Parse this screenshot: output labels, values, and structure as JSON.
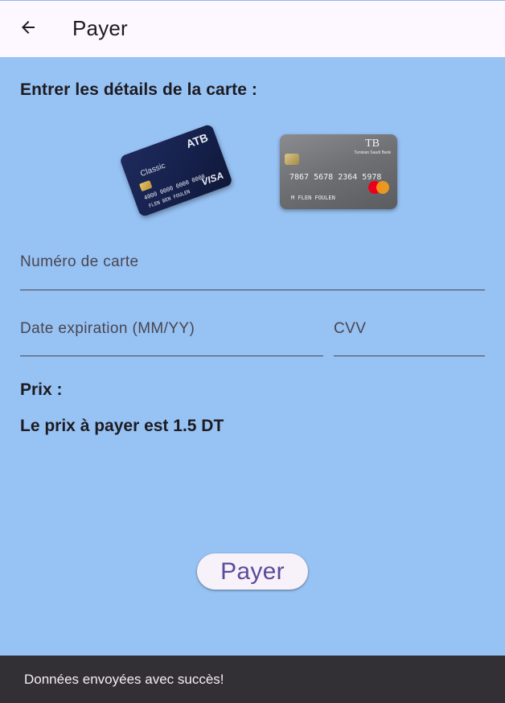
{
  "appbar": {
    "title": "Payer",
    "back_icon": "arrow-left-icon"
  },
  "card_section": {
    "title": "Entrer les détails de la carte :",
    "cards": [
      {
        "name": "ATB Classic Visa",
        "brand": "ATB",
        "tier": "Classic",
        "network": "VISA",
        "number": "4000 0000 0000 0000",
        "holder": "FLEN BEN FOULEN",
        "color": "#1e2a5c"
      },
      {
        "name": "Tunisian Saudi Bank Mastercard",
        "brand": "TB",
        "bank_name": "Tunisian Saudi Bank",
        "number": "7867 5678 2364 5978",
        "holder": "M FLEN FOULEN",
        "network": "mastercard",
        "color": "#6f7174"
      }
    ]
  },
  "form": {
    "card_number": {
      "label": "Numéro de carte",
      "value": ""
    },
    "expiration": {
      "label": "Date expiration (MM/YY)",
      "value": ""
    },
    "cvv": {
      "label": "CVV",
      "value": ""
    }
  },
  "price": {
    "label": "Prix :",
    "text": "Le prix à payer est 1.5 DT"
  },
  "pay_button": {
    "label": "Payer"
  },
  "snackbar": {
    "message": "Données envoyées avec succès!"
  },
  "colors": {
    "background": "#97c2f4",
    "appbar": "#fdf8ff",
    "button_text": "#5c4a9a",
    "snackbar": "#322f35"
  }
}
